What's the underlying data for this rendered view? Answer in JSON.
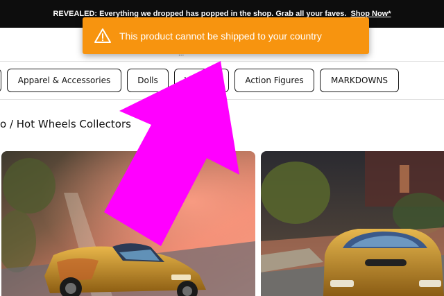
{
  "promo_bar": {
    "text": "REVEALED: Everything we dropped has popped in the shop. Grab all your faves.",
    "link": "Shop Now*"
  },
  "header": {
    "dots": "..."
  },
  "categories": [
    {
      "label": ""
    },
    {
      "label": "Apparel & Accessories"
    },
    {
      "label": "Dolls"
    },
    {
      "label": "Vehicles"
    },
    {
      "label": "Action Figures"
    },
    {
      "label": "MARKDOWNS"
    }
  ],
  "breadcrumb": {
    "text": "o / Hot Wheels Collectors"
  },
  "toast": {
    "icon": "warning-icon",
    "message": "This product cannot be shipped to your country",
    "color": "#f7940f"
  },
  "products": [
    {
      "image": "car-diorama-photo",
      "description": "gold Nissan Silvia Naruto themed die-cast on track"
    },
    {
      "image": "car-diorama-photo",
      "description": "gold Nissan Silvia Naruto themed die-cast front view"
    }
  ],
  "annotation": {
    "color": "#ff00ff",
    "icon": "pointer-arrow"
  }
}
